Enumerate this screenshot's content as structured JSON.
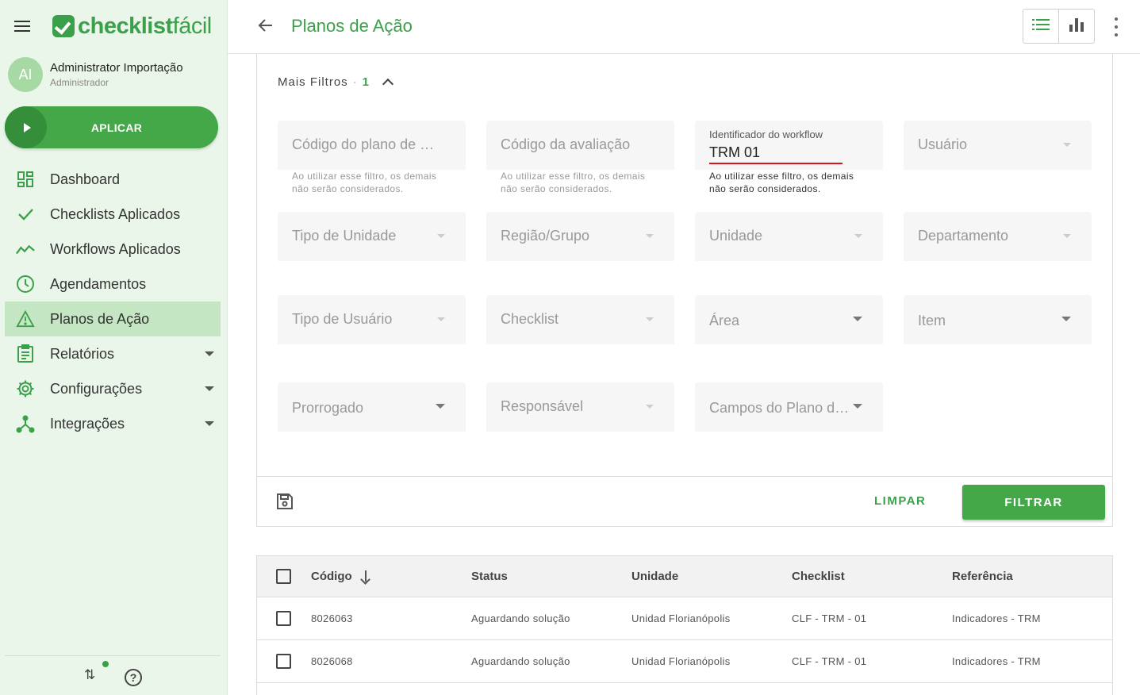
{
  "app": {
    "logo_bold": "checklist",
    "logo_light": "fácil"
  },
  "user": {
    "initials": "AI",
    "name": "Administrator Importação",
    "role": "Administrador"
  },
  "sidebar": {
    "apply_label": "APLICAR",
    "items": [
      {
        "label": "Dashboard",
        "icon": "dashboard-icon"
      },
      {
        "label": "Checklists Aplicados",
        "icon": "check-icon"
      },
      {
        "label": "Workflows Aplicados",
        "icon": "trend-icon"
      },
      {
        "label": "Agendamentos",
        "icon": "clock-icon"
      },
      {
        "label": "Planos de Ação",
        "icon": "warning-icon",
        "active": true
      },
      {
        "label": "Relatórios",
        "icon": "clipboard-icon",
        "expandable": true
      },
      {
        "label": "Configurações",
        "icon": "gear-icon",
        "expandable": true
      },
      {
        "label": "Integrações",
        "icon": "integration-icon",
        "expandable": true
      }
    ]
  },
  "header": {
    "title": "Planos de Ação"
  },
  "filters": {
    "toggle_label": "Mais Filtros",
    "active_count": "1",
    "hint": "Ao utilizar esse filtro, os demais não serão considerados.",
    "action_plan_code": "Código do plano de ação",
    "evaluation_code": "Código da avaliação",
    "workflow_label": "Identificador do workflow",
    "workflow_value": "TRM 01",
    "user": "Usuário",
    "unit_type": "Tipo de Unidade",
    "region": "Região/Grupo",
    "unit": "Unidade",
    "department": "Departamento",
    "user_type": "Tipo de Usuário",
    "checklist": "Checklist",
    "area": "Área",
    "item": "Item",
    "extended": "Prorrogado",
    "responsible": "Responsável",
    "plan_fields": "Campos do Plano de Ação",
    "clear_label": "LIMPAR",
    "filter_label": "FILTRAR"
  },
  "table": {
    "columns": [
      "Código",
      "Status",
      "Unidade",
      "Checklist",
      "Referência"
    ],
    "rows": [
      {
        "code": "8026063",
        "status": "Aguardando solução",
        "unit": "Unidad Florianópolis",
        "checklist": "CLF - TRM - 01",
        "reference": "Indicadores - TRM"
      },
      {
        "code": "8026068",
        "status": "Aguardando solução",
        "unit": "Unidad Florianópolis",
        "checklist": "CLF - TRM - 01",
        "reference": "Indicadores - TRM"
      }
    ]
  },
  "colors": {
    "brand": "#3aa14a",
    "sidebar_bg": "#eaf6e9",
    "active_item": "#c5e6c3",
    "error_underline": "#d8141a"
  }
}
